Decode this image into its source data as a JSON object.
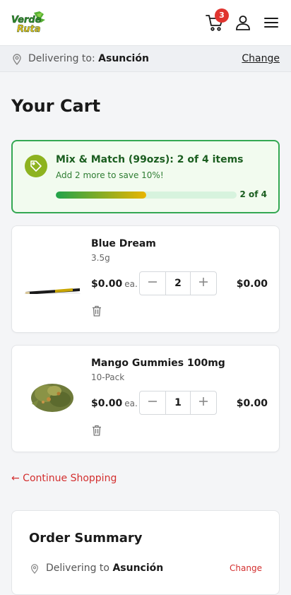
{
  "header": {
    "logo_line1": "Verde",
    "logo_line2": "Ruta",
    "cart_count": "3"
  },
  "delivery_bar": {
    "prefix": "Delivering to:",
    "city": "Asunción",
    "change_label": "Change"
  },
  "page_title": "Your Cart",
  "promo": {
    "title": "Mix & Match (99ozs): 2 of 4 items",
    "subtitle": "Add 2 more to save 10%!",
    "progress_fraction": 0.5,
    "progress_label": "2 of 4",
    "colors": {
      "border": "#34a853",
      "background": "#f2fbef",
      "fill_start": "#22a34b",
      "fill_end": "#e9b500"
    }
  },
  "items": [
    {
      "name": "Blue Dream",
      "variant": "3.5g",
      "price": "$0.00",
      "per": "ea.",
      "quantity": "2",
      "total": "$0.00",
      "image": "pre-roll-image"
    },
    {
      "name": "Mango Gummies 100mg",
      "variant": "10-Pack",
      "price": "$0.00",
      "per": "ea.",
      "quantity": "1",
      "total": "$0.00",
      "image": "flower-bud-image"
    }
  ],
  "continue_label": "← Continue Shopping",
  "summary": {
    "title": "Order Summary",
    "deliv_prefix": "Delivering to",
    "city": "Asunción",
    "change_label": "Change"
  },
  "icons": {
    "cart": "cart-icon",
    "user": "user-icon",
    "menu": "hamburger-menu-icon",
    "pin": "location-pin-icon",
    "tag": "tag-icon",
    "trash": "trash-icon",
    "minus": "minus-icon",
    "plus": "plus-icon"
  },
  "colors": {
    "accent": "#d32f2f",
    "badge": "#e0342f",
    "brand_green": "#2e7d32"
  }
}
